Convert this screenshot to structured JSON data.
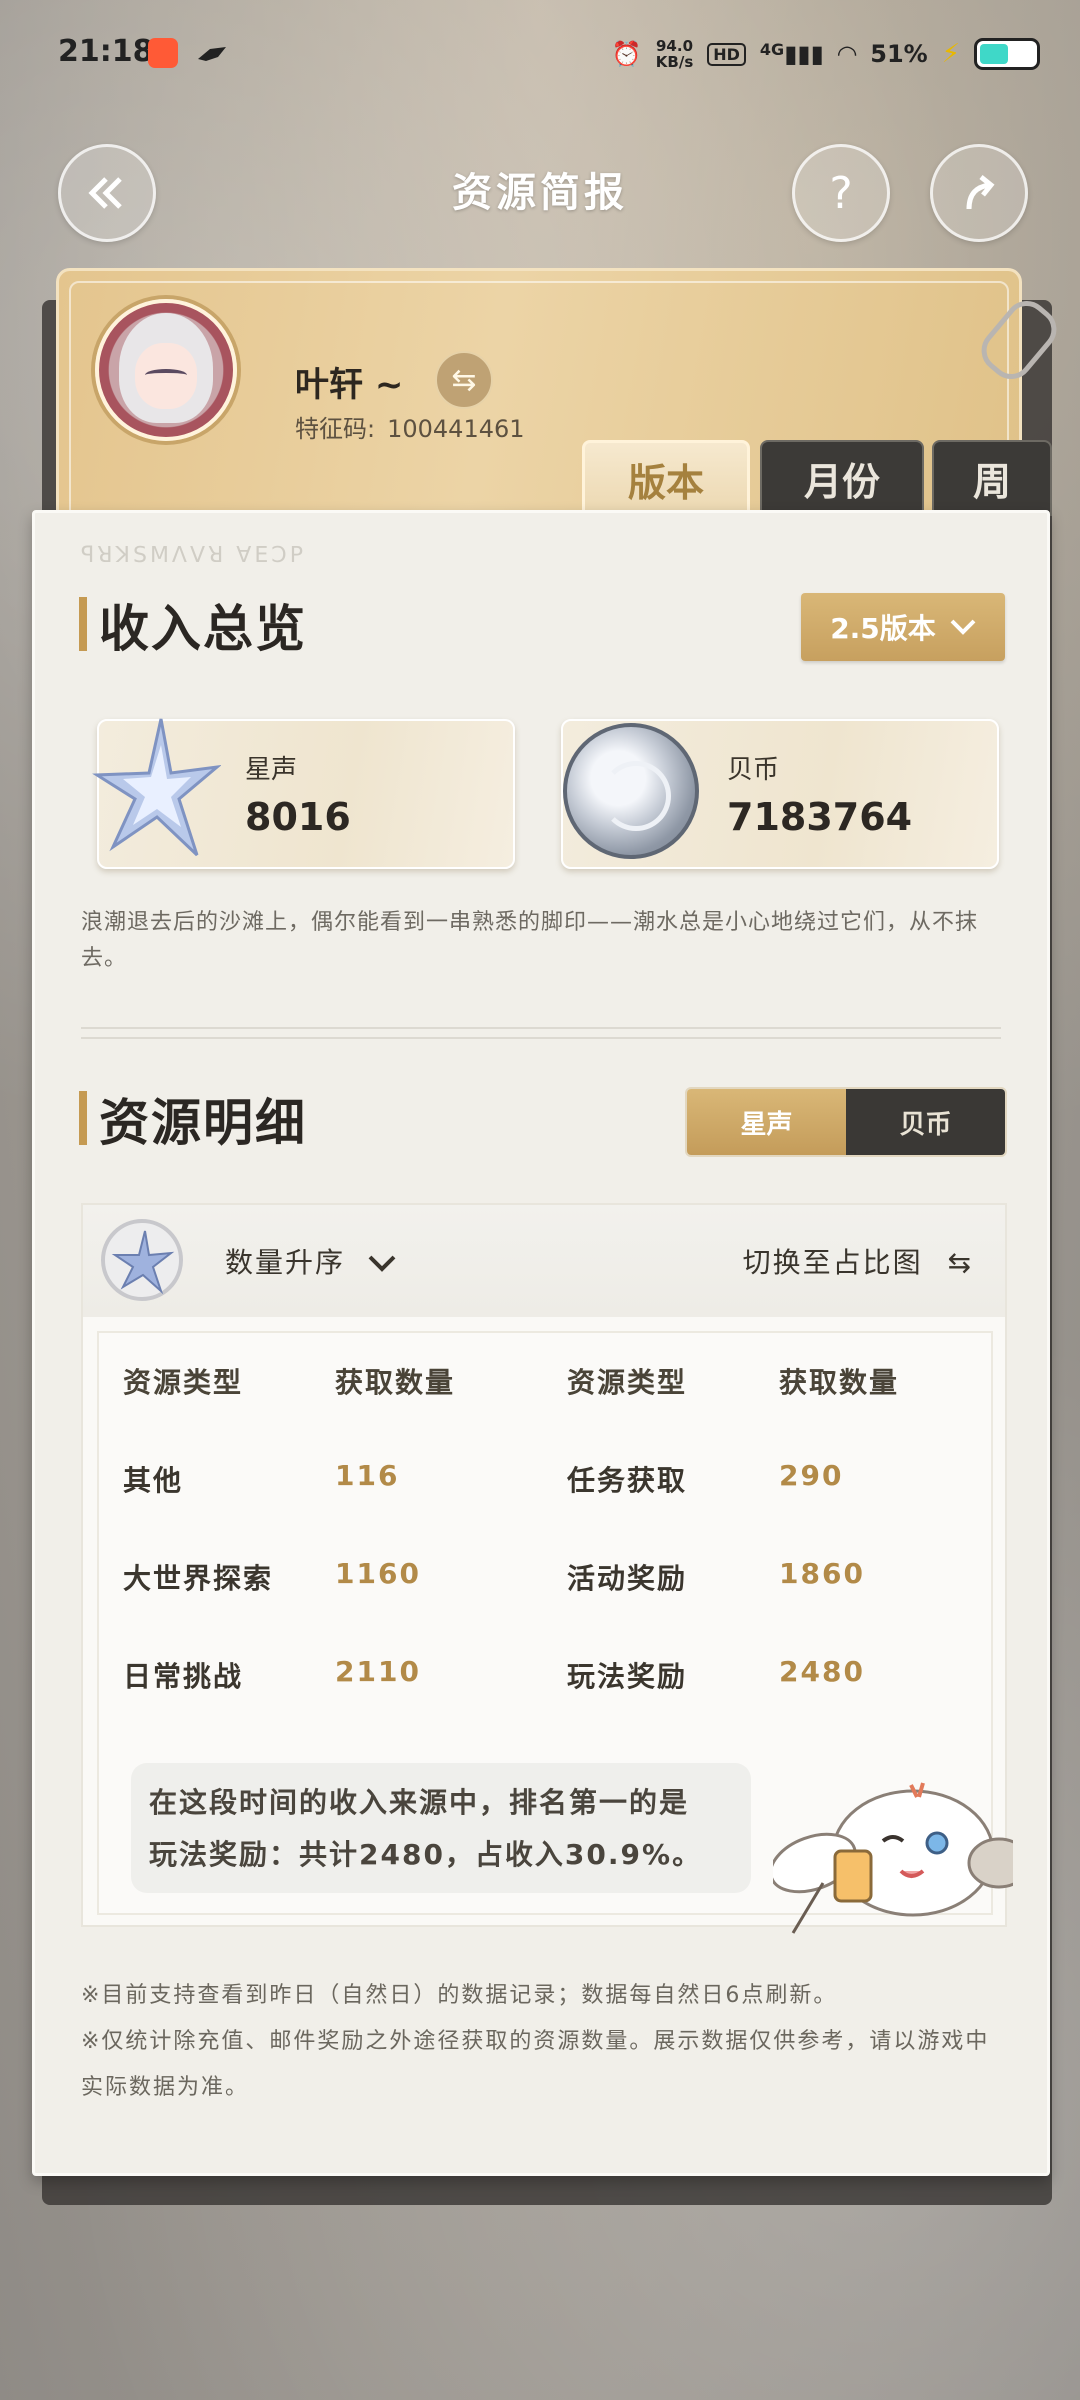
{
  "status_bar": {
    "time": "21:18",
    "net_speed_value": "94.0",
    "net_speed_unit": "KB/s",
    "hd": "HD",
    "signal": "4G",
    "battery": "51%"
  },
  "header": {
    "title": "资源简报",
    "back_icon": "back-arrow-icon",
    "help_label": "?",
    "share_icon": "share-icon"
  },
  "profile": {
    "nickname": "叶轩 ~",
    "swap_icon": "⇆",
    "uid_label": "特征码:",
    "uid": "100441461"
  },
  "tabs": [
    {
      "label": "版本",
      "active": true
    },
    {
      "label": "月份",
      "active": false
    },
    {
      "label": "周",
      "active": false
    }
  ],
  "overview": {
    "title": "收入总览",
    "version_selector": "2.5版本",
    "resources": [
      {
        "name": "星声",
        "value": "8016",
        "icon": "astrite-star-icon"
      },
      {
        "name": "贝币",
        "value": "7183764",
        "icon": "shell-coin-icon"
      }
    ],
    "description": "浪潮退去后的沙滩上，偶尔能看到一串熟悉的脚印——潮水总是小心地绕过它们，从不抹去。"
  },
  "details": {
    "title": "资源明细",
    "toggle": [
      {
        "label": "星声",
        "active": true
      },
      {
        "label": "贝币",
        "active": false
      }
    ],
    "sort_label": "数量升序",
    "switch_label": "切换至占比图",
    "columns": [
      "资源类型",
      "获取数量",
      "资源类型",
      "获取数量"
    ],
    "rows": [
      [
        "其他",
        "116",
        "任务获取",
        "290"
      ],
      [
        "大世界探索",
        "1160",
        "活动奖励",
        "1860"
      ],
      [
        "日常挑战",
        "2110",
        "玩法奖励",
        "2480"
      ]
    ],
    "summary_line1": "在这段时间的收入来源中，排名第一的是",
    "summary_line2": "玩法奖励：共计2480，占收入30.9%。"
  },
  "notes": [
    "※目前支持查看到昨日（自然日）的数据记录；数据每自然日6点刷新。",
    "※仅统计除充值、邮件奖励之外途径获取的资源数量。展示数据仅供参考，请以游戏中实际数据为准。"
  ],
  "colors": {
    "accent_gold": "#c59a52",
    "number_gold": "#b28a48",
    "dark_tab": "#3c3a37"
  }
}
